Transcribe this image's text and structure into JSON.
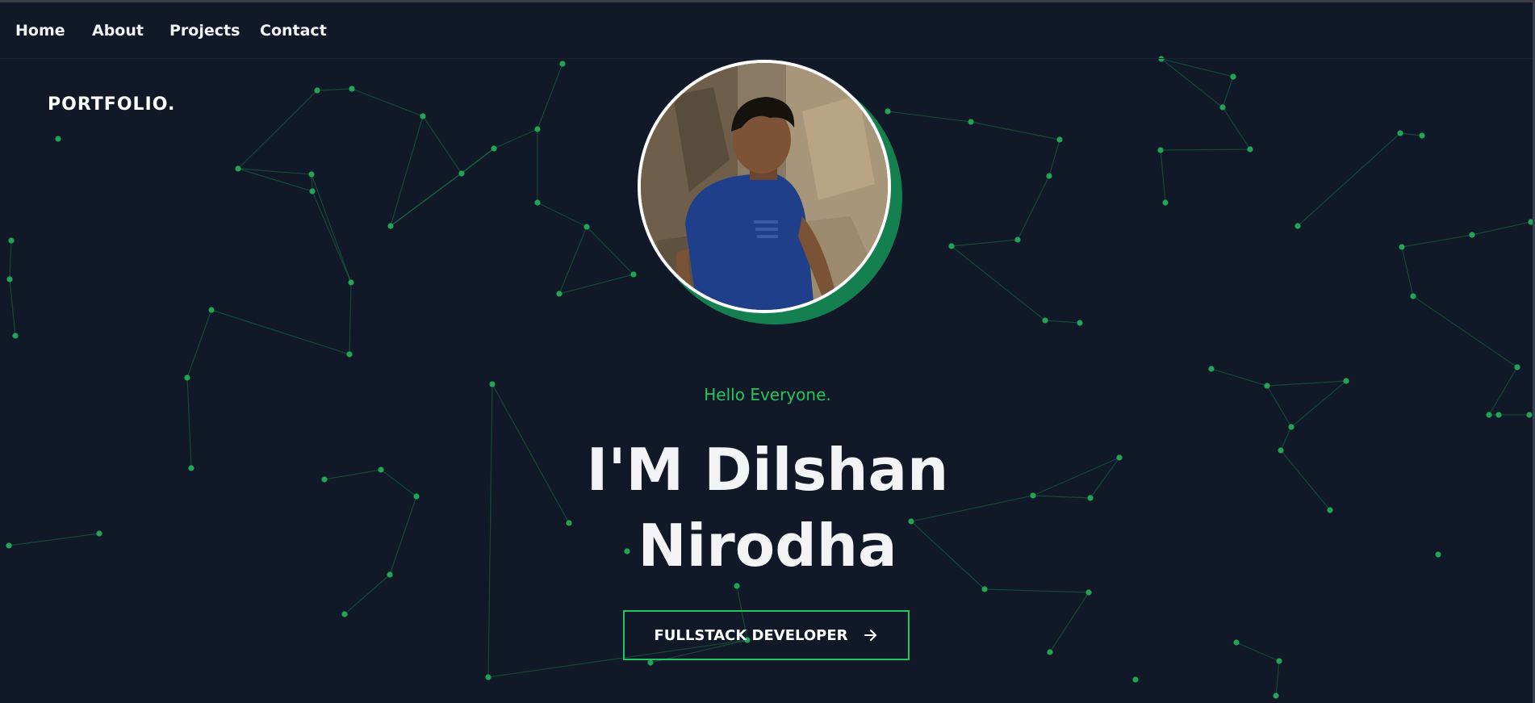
{
  "nav": {
    "items": [
      {
        "label": "Home"
      },
      {
        "label": "About"
      },
      {
        "label": "Projects"
      },
      {
        "label": "Contact"
      }
    ]
  },
  "brand": {
    "label": "PORTFOLIO."
  },
  "hero": {
    "greeting": "Hello Everyone.",
    "name_line1": "I'M Dilshan",
    "name_line2": "Nirodha",
    "cta_label": "FULLSTACK DEVELOPER",
    "cta_icon": "arrow-right-icon",
    "avatar_icon": "profile-photo"
  },
  "colors": {
    "background": "#111827",
    "accent": "#22c55e",
    "text": "#f3f4f6",
    "avatar_shadow": "#15804f"
  }
}
